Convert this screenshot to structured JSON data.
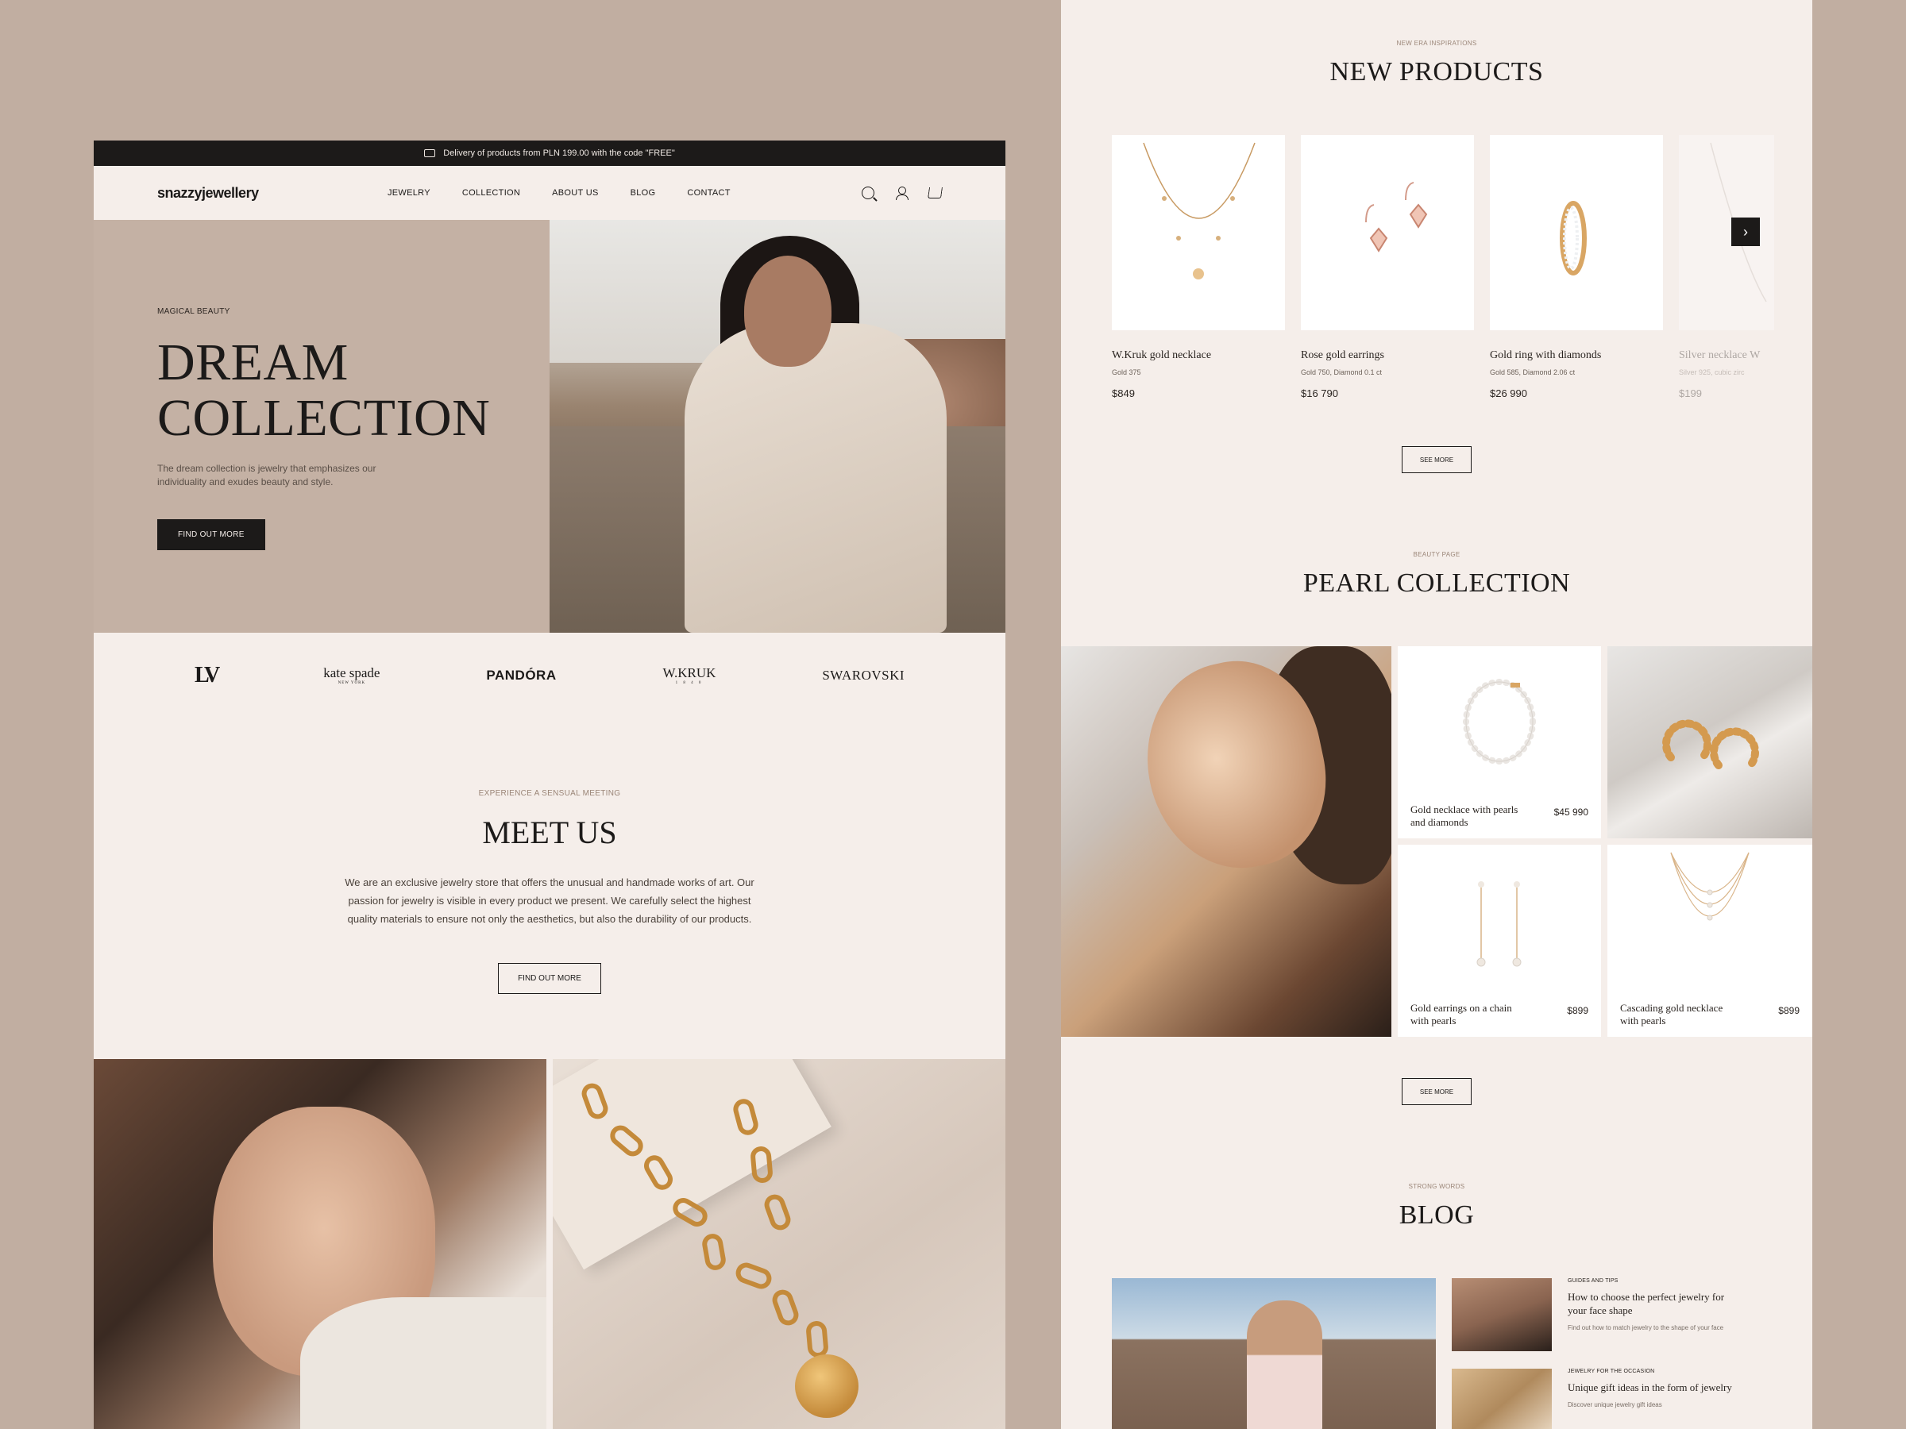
{
  "left": {
    "topbar": {
      "text": "Delivery of products from PLN 199.00 with the code \"FREE\""
    },
    "logo": "snazzyjewellery",
    "menu": [
      "JEWELRY",
      "COLLECTION",
      "ABOUT US",
      "BLOG",
      "CONTACT"
    ],
    "hero": {
      "eyebrow": "MAGICAL BEAUTY",
      "title_line1": "DREAM",
      "title_line2": "COLLECTION",
      "desc": "The dream collection is jewelry that emphasizes our individuality and exudes beauty and style.",
      "cta": "FIND OUT MORE"
    },
    "brands": {
      "lv": "LV",
      "kate": "kate spade",
      "kate_sub": "NEW YORK",
      "pandora": "PANDÓRA",
      "wkruk": "W.KRUK",
      "wkruk_sub": "1 8 4 0",
      "swarovski": "SWAROVSKI"
    },
    "meet": {
      "kicker": "EXPERIENCE A SENSUAL MEETING",
      "title": "MEET US",
      "text": "We are an exclusive jewelry store that offers the unusual and handmade works of art. Our passion for jewelry is visible in every product we present. We carefully select the highest quality materials to ensure not only the aesthetics, but also the durability of our products.",
      "cta": "FIND OUT MORE"
    }
  },
  "right": {
    "new_products": {
      "kicker": "NEW ERA INSPIRATIONS",
      "title": "NEW PRODUCTS",
      "items": [
        {
          "name": "W.Kruk gold necklace",
          "spec": "Gold 375",
          "price": "$849"
        },
        {
          "name": "Rose gold earrings",
          "spec": "Gold 750, Diamond 0.1 ct",
          "price": "$16 790"
        },
        {
          "name": "Gold ring with diamonds",
          "spec": "Gold 585, Diamond 2.06 ct",
          "price": "$26 990"
        },
        {
          "name": "Silver necklace W",
          "spec": "Silver 925, cubic zirc",
          "price": "$199"
        }
      ],
      "next_arrow": "›",
      "see_more": "SEE MORE"
    },
    "pearl": {
      "kicker": "BEAUTY PAGE",
      "title": "PEARL COLLECTION",
      "items": [
        {
          "name": "Gold necklace with pearls and diamonds",
          "price": "$45 990"
        },
        {
          "name": "Gold earrings on a chain with pearls",
          "price": "$899"
        },
        {
          "name": "Cascading gold necklace with pearls",
          "price": "$899"
        }
      ],
      "see_more": "SEE MORE"
    },
    "blog": {
      "kicker": "STRONG WORDS",
      "title": "BLOG",
      "posts": [
        {
          "category": "GUIDES AND TIPS",
          "title": "How to choose the perfect jewelry for your face shape",
          "excerpt": "Find out how to match jewelry to the shape of your face"
        },
        {
          "category": "JEWELRY FOR THE OCCASION",
          "title": "Unique gift ideas in the form of jewelry",
          "excerpt": "Discover unique jewelry gift ideas"
        }
      ]
    }
  },
  "colors": {
    "page_bg": "#c1aea1",
    "panel_bg": "#f5eeea",
    "hero_bg": "#c4b1a4",
    "dark": "#1c1a19",
    "gold": "#c48a3a"
  }
}
